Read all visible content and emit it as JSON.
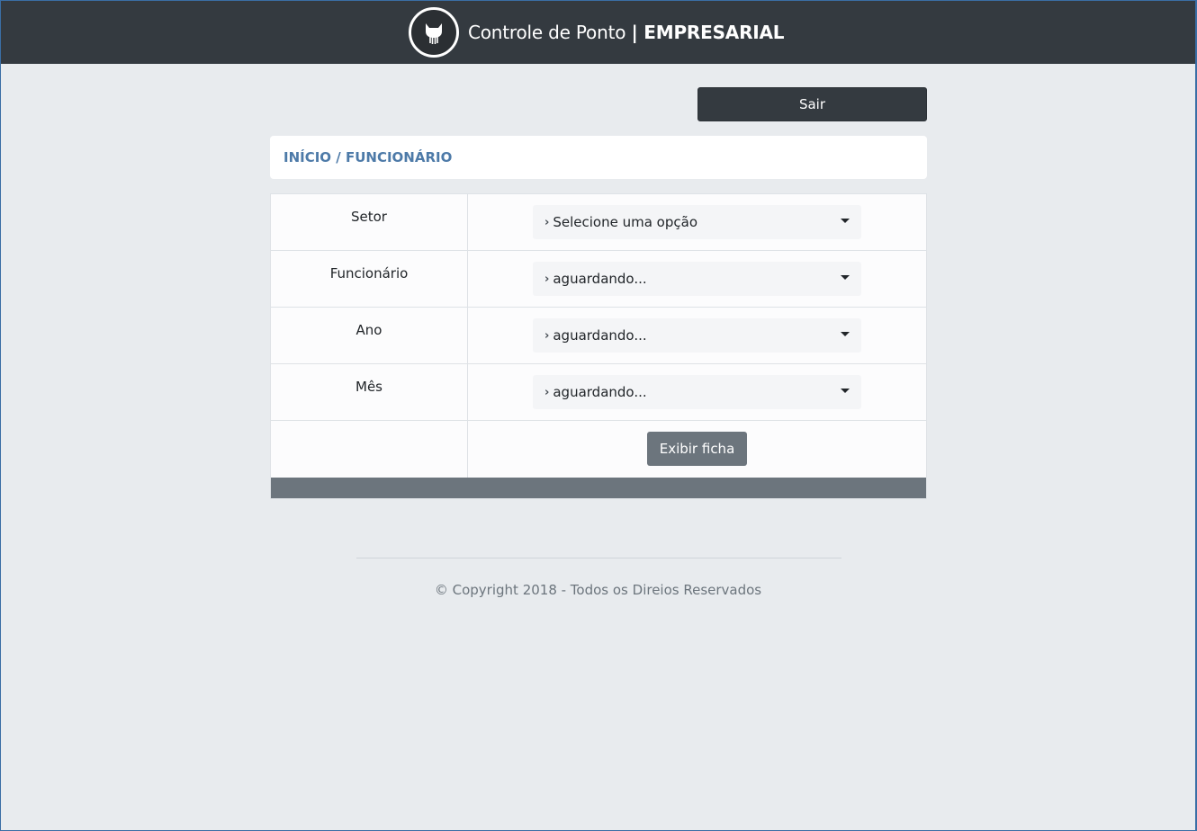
{
  "header": {
    "title_regular": "Controle de Ponto",
    "title_bold": "| EMPRESARIAL",
    "logo_icon": "github-octocat-icon"
  },
  "toolbar": {
    "logout_label": "Sair"
  },
  "breadcrumb": {
    "text": "INÍCIO / FUNCIONÁRIO"
  },
  "form": {
    "rows": [
      {
        "label": "Setor",
        "selected": "Selecione uma opção"
      },
      {
        "label": "Funcionário",
        "selected": "aguardando..."
      },
      {
        "label": "Ano",
        "selected": "aguardando..."
      },
      {
        "label": "Mês",
        "selected": "aguardando..."
      }
    ],
    "submit_label": "Exibir ficha"
  },
  "footer": {
    "copyright": "© Copyright 2018 - Todos os Direios Reservados"
  },
  "colors": {
    "navbar": "#343a40",
    "background": "#e8ebee",
    "breadcrumb_text": "#4d7aa8",
    "secondary_button": "#6c757d"
  }
}
